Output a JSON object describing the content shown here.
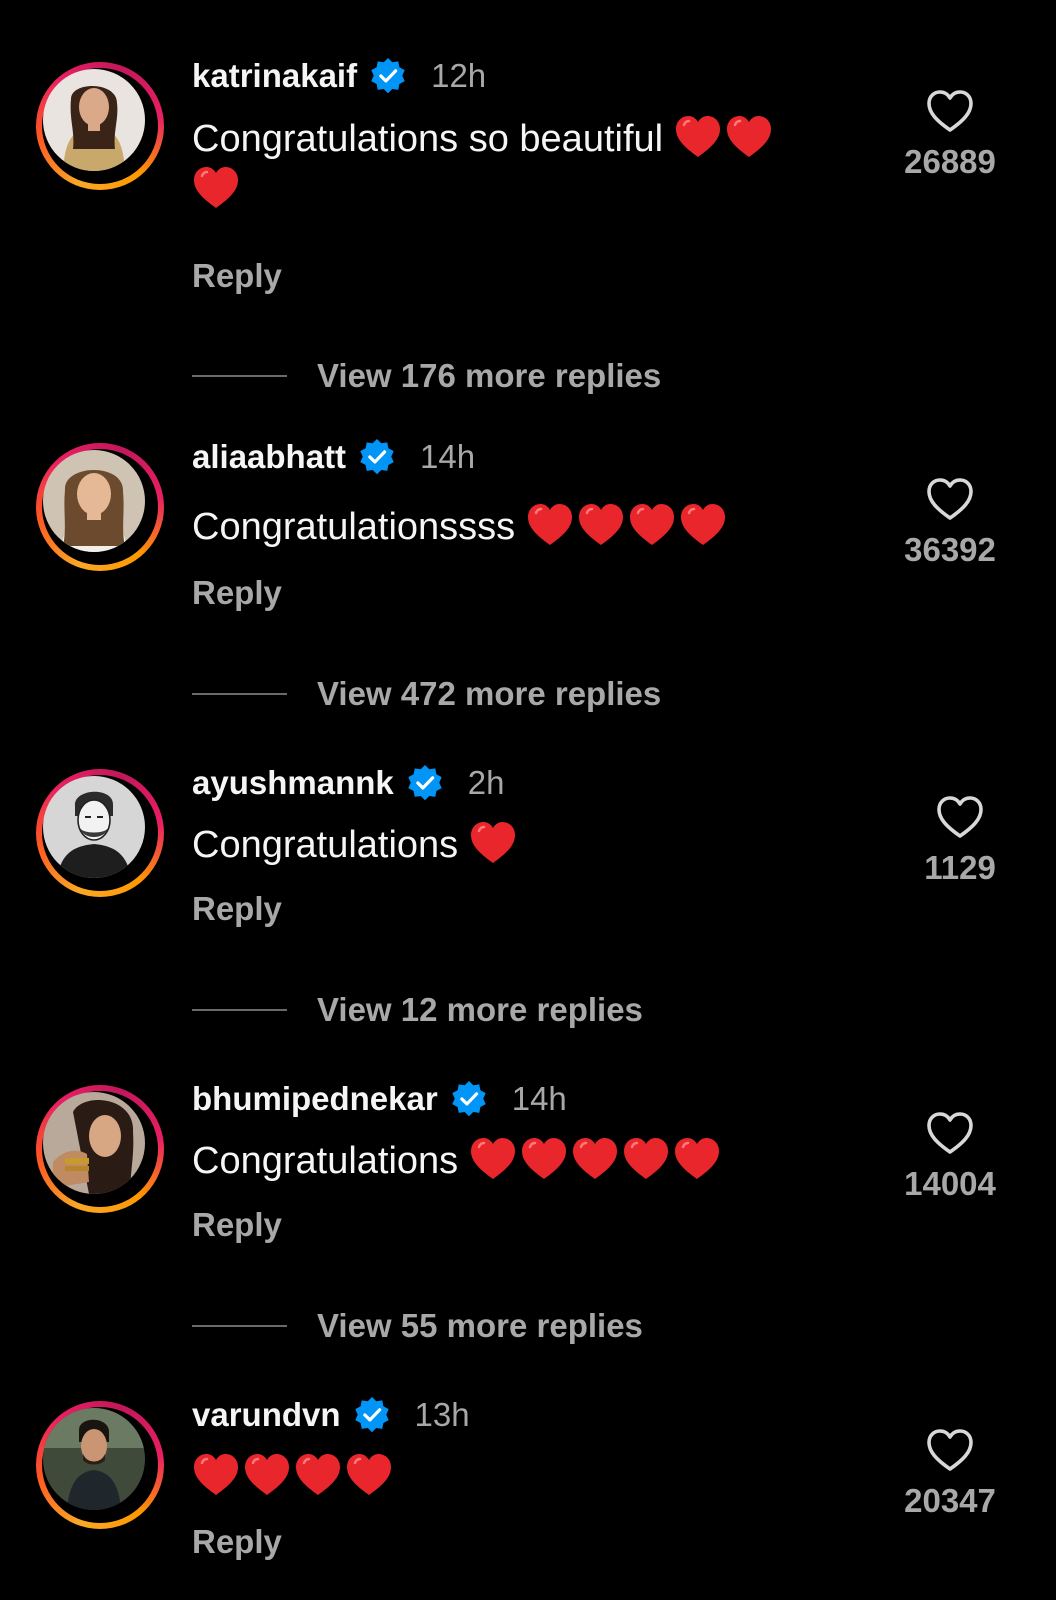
{
  "comments": [
    {
      "username": "katrinakaif",
      "time": "12h",
      "text": "Congratulations so beautiful",
      "hearts_inline": 2,
      "hearts_wrapped": 1,
      "reply_label": "Reply",
      "likes": "26889",
      "view_more": "View 176 more replies"
    },
    {
      "username": "aliaabhatt",
      "time": "14h",
      "text": "Congratulationssss",
      "hearts_inline": 4,
      "reply_label": "Reply",
      "likes": "36392",
      "view_more": "View 472 more replies"
    },
    {
      "username": "ayushmannk",
      "time": "2h",
      "text": "Congratulations",
      "hearts_inline": 1,
      "reply_label": "Reply",
      "likes": "1129",
      "view_more": "View 12 more replies"
    },
    {
      "username": "bhumipednekar",
      "time": "14h",
      "text": "Congratulations",
      "hearts_inline": 5,
      "reply_label": "Reply",
      "likes": "14004",
      "view_more": "View 55 more replies"
    },
    {
      "username": "varundvn",
      "time": "13h",
      "text": "",
      "hearts_inline": 4,
      "reply_label": "Reply",
      "likes": "20347"
    }
  ],
  "icons": {
    "verified": "verified-badge-icon",
    "like": "heart-outline-icon",
    "emoji": "red-heart-emoji"
  },
  "colors": {
    "background": "#000000",
    "verified_blue": "#0095f6",
    "heart_red": "#e8262b",
    "muted_text": "#a8a8a8"
  }
}
